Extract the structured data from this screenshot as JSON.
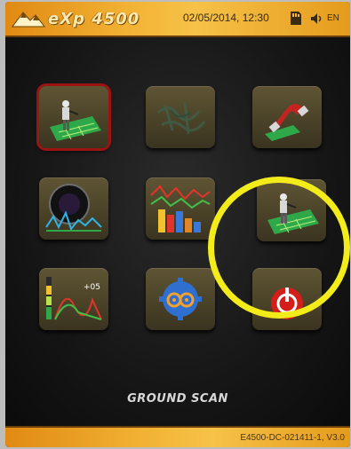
{
  "header": {
    "logo_text": "eXp 4500",
    "datetime": "02/05/2014, 12:30",
    "language": "EN",
    "icons": [
      "sd-card-icon",
      "speaker-icon"
    ]
  },
  "menu": {
    "tiles": [
      {
        "name": "ground-scan",
        "icon": "ground-scan-icon",
        "selected": true
      },
      {
        "name": "tunnel-scan",
        "icon": "tunnel-scan-icon",
        "selected": false
      },
      {
        "name": "magnetometer",
        "icon": "magnet-icon",
        "selected": false
      },
      {
        "name": "live-stream",
        "icon": "live-stream-icon",
        "selected": false
      },
      {
        "name": "discrimination",
        "icon": "discrimination-icon",
        "selected": false
      },
      {
        "name": "ground-scan-alt",
        "icon": "ground-scan-icon",
        "selected": false
      },
      {
        "name": "system-check",
        "icon": "signal-graph-icon",
        "selected": false
      },
      {
        "name": "settings",
        "icon": "gears-icon",
        "selected": false
      },
      {
        "name": "power",
        "icon": "power-icon",
        "selected": false
      }
    ],
    "signal_tile_text": "+05"
  },
  "mode_label": "GROUND SCAN",
  "footer": {
    "version": "E4500-DC-021411-1, V3.0"
  },
  "colors": {
    "bar": "#f2b233",
    "ring": "#f3ec1a",
    "selected_border": "#9c1410",
    "tile": "#4b4328"
  }
}
